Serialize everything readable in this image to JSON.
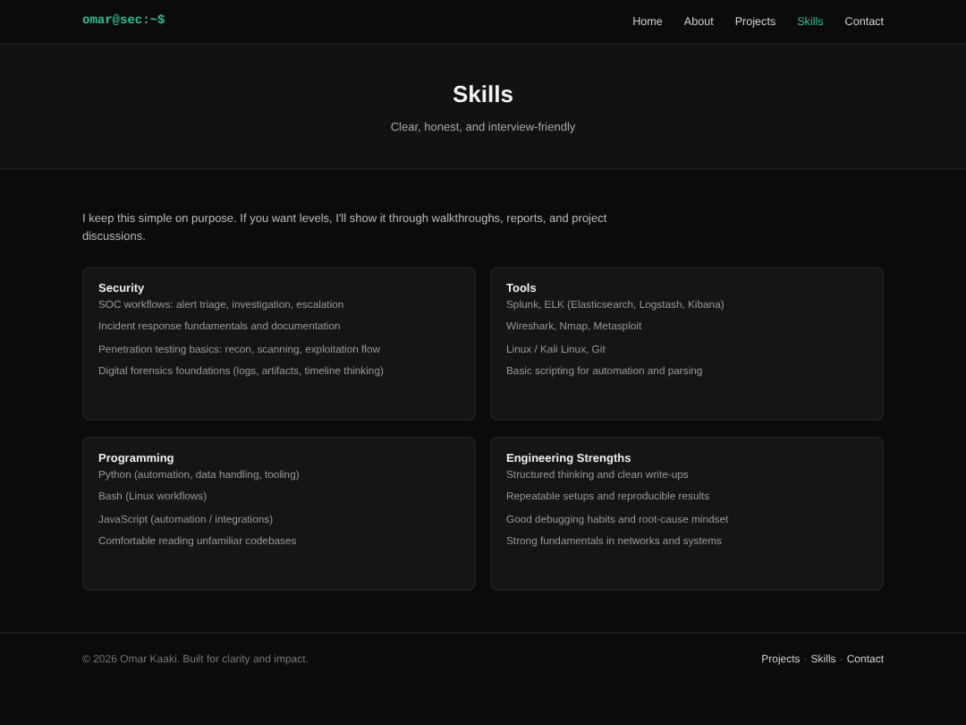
{
  "nav": {
    "brand": "omar@sec:~$",
    "links": [
      {
        "label": "Home",
        "selected": false
      },
      {
        "label": "About",
        "selected": false
      },
      {
        "label": "Projects",
        "selected": false
      },
      {
        "label": "Skills",
        "selected": true
      },
      {
        "label": "Contact",
        "selected": false
      }
    ]
  },
  "hero": {
    "title": "Skills",
    "subtitle": "Clear, honest, and interview-friendly"
  },
  "intro": "I keep this simple on purpose. If you want levels, I'll show it through walkthroughs, reports, and project discussions.",
  "cards": [
    {
      "title": "Security",
      "items": [
        "SOC workflows: alert triage, investigation, escalation",
        "Incident response fundamentals and documentation",
        "Penetration testing basics: recon, scanning, exploitation flow",
        "Digital forensics foundations (logs, artifacts, timeline thinking)"
      ]
    },
    {
      "title": "Tools",
      "items": [
        "Splunk, ELK (Elasticsearch, Logstash, Kibana)",
        "Wireshark, Nmap, Metasploit",
        "Linux / Kali Linux, Git",
        "Basic scripting for automation and parsing"
      ]
    },
    {
      "title": "Programming",
      "items": [
        "Python (automation, data handling, tooling)",
        "Bash (Linux workflows)",
        "JavaScript (automation / integrations)",
        "Comfortable reading unfamiliar codebases"
      ]
    },
    {
      "title": "Engineering Strengths",
      "items": [
        "Structured thinking and clean write-ups",
        "Repeatable setups and reproducible results",
        "Good debugging habits and root-cause mindset",
        "Strong fundamentals in networks and systems"
      ]
    }
  ],
  "footer": {
    "copyright": "© 2026 Omar Kaaki. Built for clarity and impact.",
    "separator": "·",
    "links": [
      "Projects",
      "Skills",
      "Contact"
    ]
  }
}
